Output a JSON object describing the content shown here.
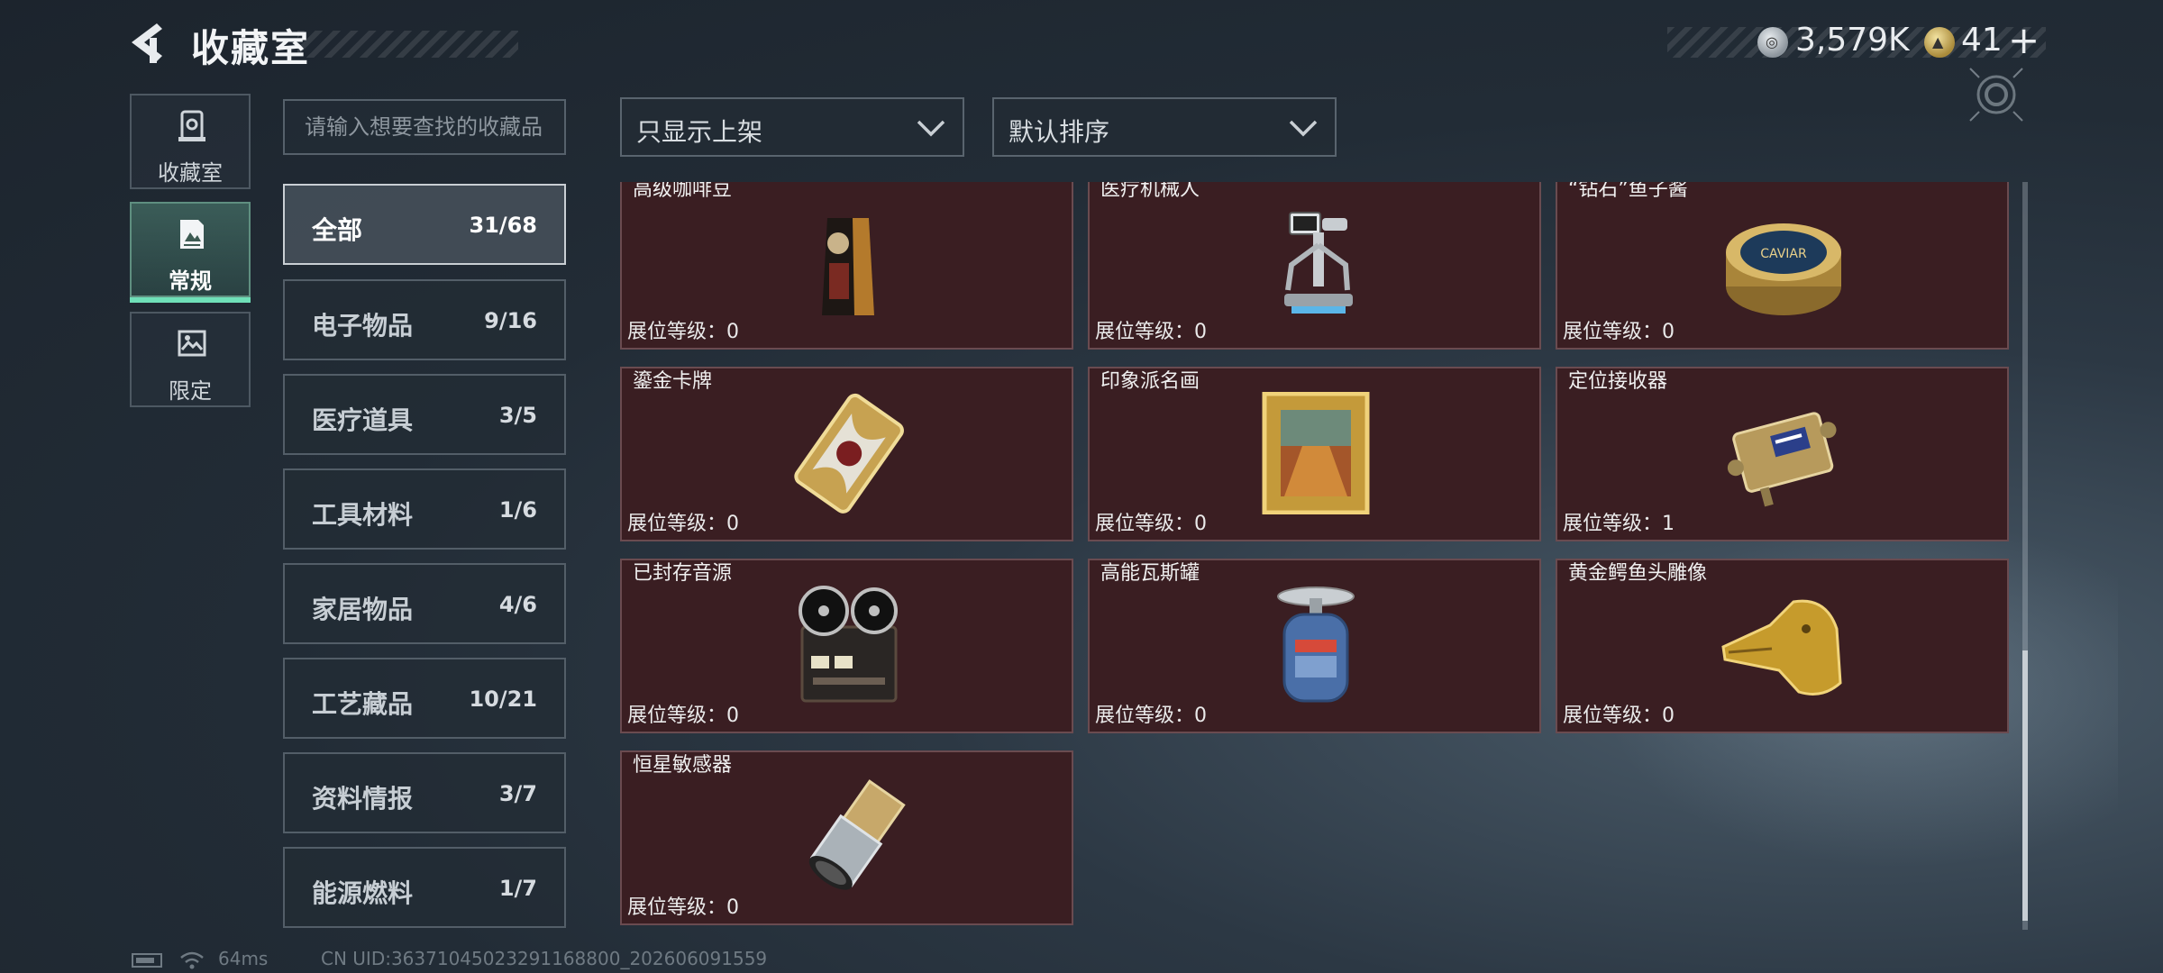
{
  "header": {
    "title": "收藏室",
    "currency": [
      {
        "icon": "silver-coin-icon",
        "value": "3,579K"
      },
      {
        "icon": "gold-coin-icon",
        "value": "41"
      }
    ],
    "plus_label": "+"
  },
  "rail": [
    {
      "label": "收藏室",
      "icon": "collection-room-icon",
      "active": false
    },
    {
      "label": "常规",
      "icon": "regular-document-icon",
      "active": true
    },
    {
      "label": "限定",
      "icon": "limited-image-icon",
      "active": false
    }
  ],
  "search": {
    "placeholder": "请输入想要查找的收藏品"
  },
  "filters": {
    "shelf": "只显示上架",
    "sort": "默认排序"
  },
  "categories": [
    {
      "name": "全部",
      "count": "31/68",
      "active": true
    },
    {
      "name": "电子物品",
      "count": "9/16"
    },
    {
      "name": "医疗道具",
      "count": "3/5"
    },
    {
      "name": "工具材料",
      "count": "1/6"
    },
    {
      "name": "家居物品",
      "count": "4/6"
    },
    {
      "name": "工艺藏品",
      "count": "10/21"
    },
    {
      "name": "资料情报",
      "count": "3/7"
    },
    {
      "name": "能源燃料",
      "count": "1/7"
    }
  ],
  "items": [
    {
      "name": "高级咖啡豆",
      "level": "展位等级：0",
      "icon": "coffee-bag-icon"
    },
    {
      "name": "医疗机械人",
      "level": "展位等级：0",
      "icon": "medical-robot-icon"
    },
    {
      "name": "“钻石”鱼子酱",
      "level": "展位等级：0",
      "icon": "caviar-tin-icon",
      "tin_text": "CAVIAR"
    },
    {
      "name": "鎏金卡牌",
      "level": "展位等级：0",
      "icon": "gilded-card-icon"
    },
    {
      "name": "印象派名画",
      "level": "展位等级：0",
      "icon": "framed-painting-icon"
    },
    {
      "name": "定位接收器",
      "level": "展位等级：1",
      "icon": "locator-receiver-icon"
    },
    {
      "name": "已封存音源",
      "level": "展位等级：0",
      "icon": "reel-recorder-icon"
    },
    {
      "name": "高能瓦斯罐",
      "level": "展位等级：0",
      "icon": "gas-canister-icon"
    },
    {
      "name": "黄金鳄鱼头雕像",
      "level": "展位等级：0",
      "icon": "gold-crocodile-icon"
    },
    {
      "name": "恒星敏感器",
      "level": "展位等级：0",
      "icon": "star-sensor-icon"
    }
  ],
  "status": {
    "ping": "64ms",
    "uid": "CN UID:36371045023291168800_202606091559"
  },
  "colors": {
    "card_bg": "#3a1e22",
    "card_border": "#6a4b50",
    "active_tab": "#6fe0b8",
    "background": "#222c36"
  }
}
